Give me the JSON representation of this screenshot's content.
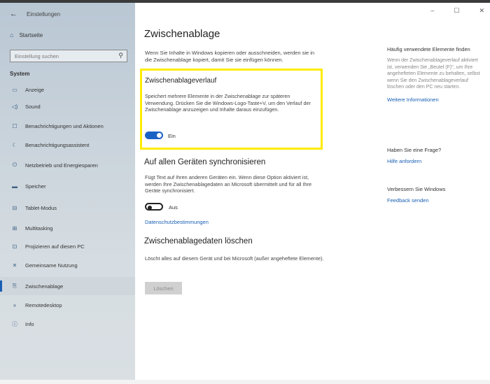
{
  "window": {
    "title": "Einstellungen",
    "min_glyph": "–",
    "max_glyph": "☐",
    "close_glyph": "✕"
  },
  "sidebar": {
    "home_label": "Startseite",
    "search_placeholder": "Einstellung suchen",
    "section_label": "System",
    "items": [
      {
        "label": "Anzeige",
        "icon": "display-icon",
        "glyph": "▭"
      },
      {
        "label": "Sound",
        "icon": "sound-icon",
        "glyph": "◁)"
      },
      {
        "label": "Benachrichtigungen und Aktionen",
        "icon": "notifications-icon",
        "glyph": "☐"
      },
      {
        "label": "Benachrichtigungsassistent",
        "icon": "focus-assist-icon",
        "glyph": "☾"
      },
      {
        "label": "Netzbetrieb und Energiesparen",
        "icon": "power-icon",
        "glyph": "⏻"
      },
      {
        "label": "Speicher",
        "icon": "storage-icon",
        "glyph": "▬"
      },
      {
        "label": "Tablet-Modus",
        "icon": "tablet-icon",
        "glyph": "⊟"
      },
      {
        "label": "Multitasking",
        "icon": "multitasking-icon",
        "glyph": "⊞"
      },
      {
        "label": "Projizieren auf diesen PC",
        "icon": "project-icon",
        "glyph": "⊡"
      },
      {
        "label": "Gemeinsame Nutzung",
        "icon": "shared-icon",
        "glyph": "✕"
      },
      {
        "label": "Zwischenablage",
        "icon": "clipboard-icon",
        "glyph": "⎘",
        "active": true
      },
      {
        "label": "Remotedesktop",
        "icon": "remote-desktop-icon",
        "glyph": "»"
      },
      {
        "label": "Info",
        "icon": "info-icon",
        "glyph": "ⓘ"
      }
    ]
  },
  "main": {
    "title": "Zwischenablage",
    "intro": "Wenn Sie Inhalte in Windows kopieren oder ausschneiden, werden sie in die Zwischenablage kopiert, damit Sie sie einfügen können.",
    "history": {
      "title": "Zwischenablageverlauf",
      "description": "Speichert mehrere Elemente in der Zwischenablage zur späteren Verwendung. Drücken Sie die Windows-Logo-Taste+V, um den Verlauf der Zwischenablage anzuzeigen und Inhalte daraus einzufügen.",
      "toggle_state": "Ein",
      "toggle_on": true
    },
    "sync": {
      "title": "Auf allen Geräten synchronisieren",
      "description": "Fügt Text auf Ihren anderen Geräten ein. Wenn diese Option aktiviert ist, werden Ihre Zwischenablagedaten an Microsoft übermittelt und für all Ihre Geräte synchronisiert.",
      "toggle_state": "Aus",
      "toggle_on": false,
      "privacy_link": "Datenschutzbestimmungen"
    },
    "clear": {
      "title": "Zwischenablagedaten löschen",
      "description": "Löscht alles auf diesem Gerät und bei Microsoft (außer angeheftete Elemente).",
      "button_label": "Löschen"
    }
  },
  "right_panel": {
    "faq_heading": "Häufig verwendete Elemente finden",
    "faq_text": "Wenn der Zwischenablageverlauf aktiviert ist, verwenden Sie „Beutel (F)\", um Ihre angehefteten Elemente zu behalten, selbst wenn Sie den Zwischenablageverlauf löschen oder den PC neu starten.",
    "faq_link": "Weitere Informationen",
    "help_heading": "Haben Sie eine Frage?",
    "help_link": "Hilfe anfordern",
    "improve_heading": "Verbessern Sie Windows",
    "improve_link": "Feedback senden"
  }
}
